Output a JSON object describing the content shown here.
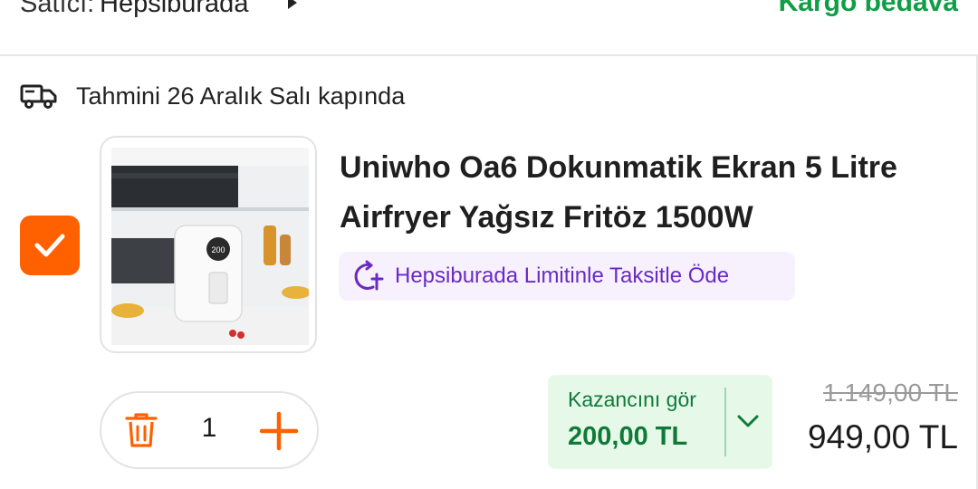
{
  "seller": {
    "prefix": "Satıcı:",
    "name": "Hepsiburada",
    "shipping": "Kargo bedava"
  },
  "delivery": {
    "icon": "truck-icon",
    "text": "Tahmini 26 Aralık Salı kapında"
  },
  "product": {
    "selected": true,
    "title": "Uniwho Oa6 Dokunmatik Ekran 5 Litre Airfryer Yağsız Fritöz 1500W",
    "installment_text": "Hepsiburada Limitinle Taksitle Öde",
    "image_display_value": "200"
  },
  "quantity": {
    "value": "1",
    "decrease_icon": "trash-icon",
    "increase_icon": "plus-icon"
  },
  "gain": {
    "label": "Kazancını gör",
    "amount": "200,00 TL"
  },
  "pricing": {
    "old_price": "1.149,00 TL",
    "price": "949,00 TL"
  },
  "colors": {
    "accent": "#ff6000",
    "success": "#0f9e45",
    "purple": "#6a2bc4"
  }
}
